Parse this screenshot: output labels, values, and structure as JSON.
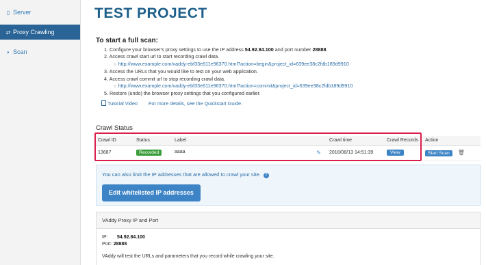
{
  "sidebar": {
    "items": [
      {
        "label": "Server",
        "icon": "server-icon"
      },
      {
        "label": "Proxy Crawling",
        "icon": "arrows-icon",
        "active": true
      },
      {
        "label": "Scan",
        "icon": "shield-icon"
      }
    ]
  },
  "page": {
    "title": "TEST PROJECT",
    "subhead": "To start a full scan:",
    "steps": {
      "s1_pre": "1. Configure your browser's proxy settings to use the IP address ",
      "s1_ip": "54.92.84.100",
      "s1_mid": " and port number ",
      "s1_port": "28888",
      "s1_post": ".",
      "s2": "2. Access crawl start url to start recording crawl data.",
      "s2_url": "http://www.example.com/vaddy-ebf33e611e96370.html?action=begin&project_id=639ee38c2fdb189d9910",
      "s3": "3. Access the URLs that you would like to test on your web application.",
      "s4": "4. Access crawl commit url to stop recording crawl data.",
      "s4_url": "http://www.example.com/vaddy-ebf33e611e96370.html?action=commit&project_id=639ee38c2fdb189d9910",
      "s5": "5. Restore (undo) the browser proxy settings that you configured earlier."
    },
    "links": {
      "tutorial": "Tutorial Video",
      "quickstart": "For more details, see the Quickstart Guide."
    }
  },
  "crawl": {
    "heading": "Crawl Status",
    "columns": [
      "Crawl ID",
      "Status",
      "Label",
      "Crawl time",
      "Crawl Records",
      "Action"
    ],
    "rows": [
      {
        "id": "13687",
        "status": "Recorded",
        "label": "aaaa",
        "time": "2018/08/13 14:51:39",
        "records_btn": "View",
        "action_btn": "Start Scan"
      }
    ],
    "status_color": "#3a9d3a",
    "highlight_color": "#d91e4b"
  },
  "whitelist": {
    "note": "You can also limit the IP addresses that are allowed to crawl your site.",
    "button": "Edit whitelisted IP addresses"
  },
  "proxy": {
    "heading": "VAddy Proxy IP and Port",
    "ip_label": "IP:",
    "ip": "54.92.84.100",
    "port_label": "Port:",
    "port": "28888",
    "desc": "VAddy will test the URLs and parameters that you record while crawling your site."
  },
  "colors": {
    "accent": "#3d84c6",
    "title": "#1d5f8a",
    "sidebar_active": "#2a6496"
  }
}
